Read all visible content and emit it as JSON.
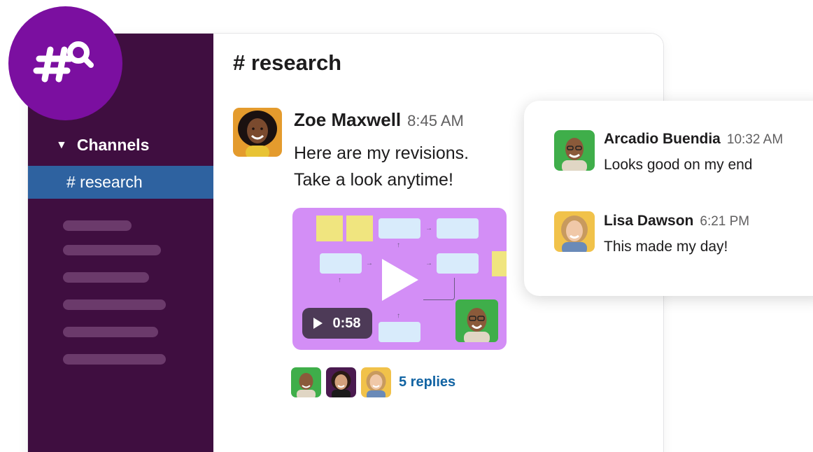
{
  "logo": {
    "icon": "hash-search-icon",
    "color": "#7b0fa0"
  },
  "sidebar": {
    "section_label": "Channels",
    "caret_glyph": "▼",
    "active_channel": "# research",
    "background": "#3f0e40",
    "highlight": "#2e62a0"
  },
  "channel": {
    "title": "# research"
  },
  "message": {
    "author": "Zoe Maxwell",
    "time": "8:45 AM",
    "text_line1": "Here are my revisions.",
    "text_line2": "Take a look anytime!",
    "video": {
      "duration": "0:58",
      "background": "#d38ef6"
    },
    "replies_label": "5 replies"
  },
  "thread": {
    "messages": [
      {
        "author": "Arcadio Buendia",
        "time": "10:32 AM",
        "text": "Looks good on my end"
      },
      {
        "author": "Lisa Dawson",
        "time": "6:21 PM",
        "text": "This made my day!"
      }
    ]
  }
}
